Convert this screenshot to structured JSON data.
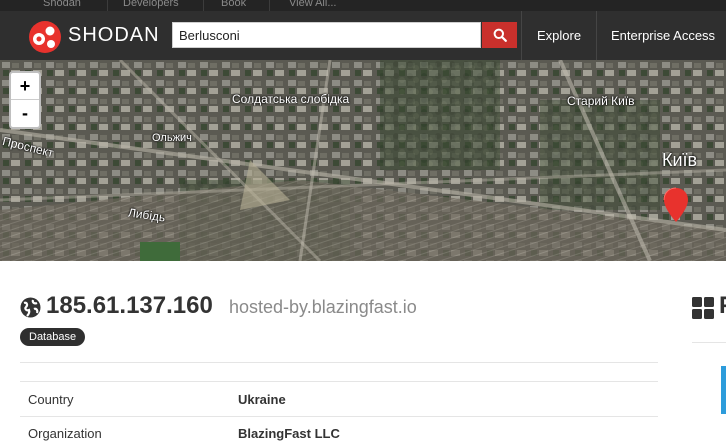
{
  "topbar": {
    "links": [
      "Shodan",
      "Developers",
      "Book",
      "View All..."
    ]
  },
  "header": {
    "logo_text": "SHODAN",
    "search_value": "Berlusconi",
    "nav": [
      "Explore",
      "Enterprise Access"
    ]
  },
  "map": {
    "zoom_in": "+",
    "zoom_out": "-",
    "labels": [
      "Солдатська слобідка",
      "Старий Київ",
      "Київ",
      "Либідь",
      "Ольжич",
      "Проспект"
    ]
  },
  "host": {
    "ip": "185.61.137.160",
    "hostname": "hosted-by.blazingfast.io",
    "tag": "Database",
    "details": [
      {
        "label": "Country",
        "value": "Ukraine"
      },
      {
        "label": "Organization",
        "value": "BlazingFast LLC"
      }
    ]
  },
  "sidebar": {
    "title": "P"
  },
  "colors": {
    "header_bg": "#2f2f2f",
    "search_button": "#c9302c",
    "marker": "#e8322d",
    "accent": "#2d9cdb"
  }
}
